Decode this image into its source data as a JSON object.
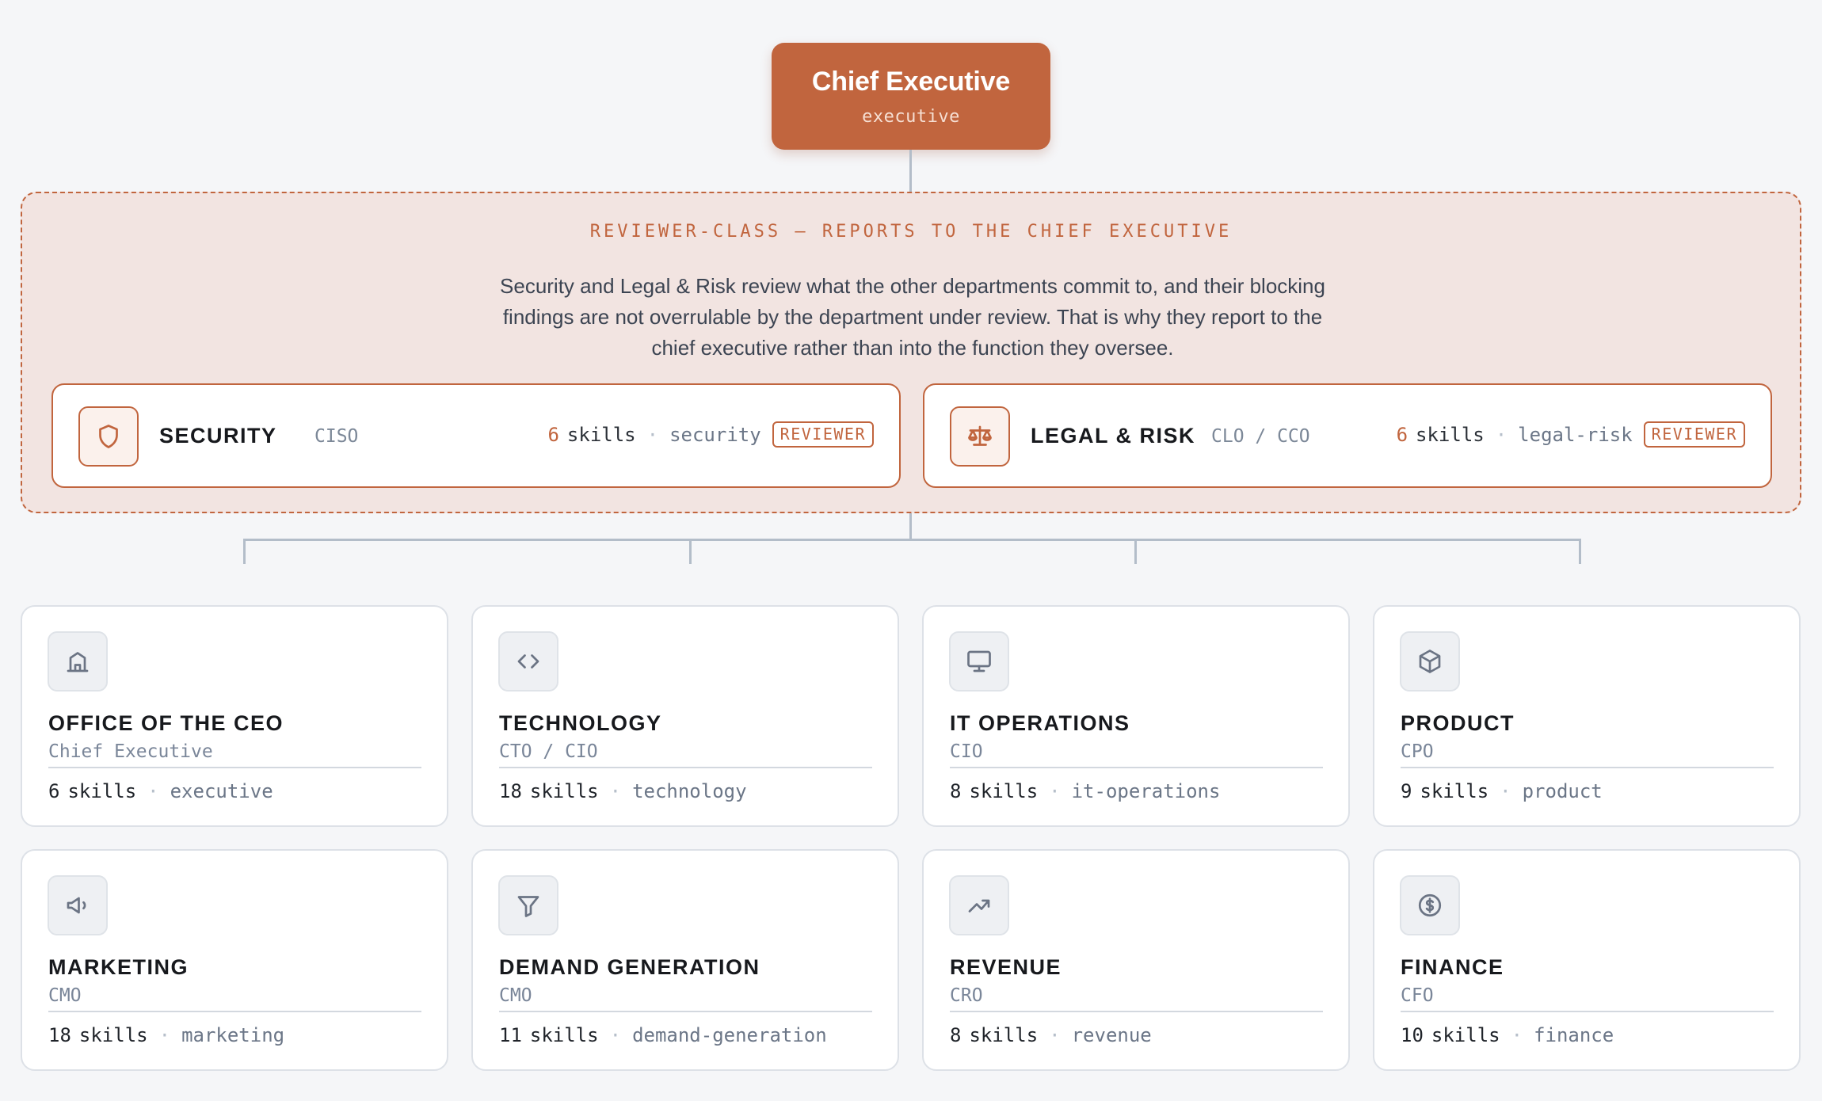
{
  "executive": {
    "title": "Chief Executive",
    "slug": "executive"
  },
  "reviewer_panel": {
    "heading": "REVIEWER-CLASS — REPORTS TO THE CHIEF EXECUTIVE",
    "description": "Security and Legal & Risk review what the other departments commit to, and their blocking findings are not overrulable by the department under review. That is why they report to the chief executive rather than into the function they oversee.",
    "cards": [
      {
        "icon": "shield-icon",
        "name": "SECURITY",
        "role": "CISO",
        "count": "6",
        "skills_label": "skills",
        "separator": "·",
        "slug": "security",
        "badge": "REVIEWER"
      },
      {
        "icon": "scales-icon",
        "name": "LEGAL & RISK",
        "role": "CLO / CCO",
        "count": "6",
        "skills_label": "skills",
        "separator": "·",
        "slug": "legal-risk",
        "badge": "REVIEWER"
      }
    ]
  },
  "departments": [
    {
      "icon": "building-icon",
      "name": "OFFICE OF THE CEO",
      "role": "Chief Executive",
      "count": "6",
      "skills_label": "skills",
      "separator": "·",
      "slug": "executive"
    },
    {
      "icon": "code-icon",
      "name": "TECHNOLOGY",
      "role": "CTO / CIO",
      "count": "18",
      "skills_label": "skills",
      "separator": "·",
      "slug": "technology"
    },
    {
      "icon": "monitor-icon",
      "name": "IT OPERATIONS",
      "role": "CIO",
      "count": "8",
      "skills_label": "skills",
      "separator": "·",
      "slug": "it-operations"
    },
    {
      "icon": "box-icon",
      "name": "PRODUCT",
      "role": "CPO",
      "count": "9",
      "skills_label": "skills",
      "separator": "·",
      "slug": "product"
    },
    {
      "icon": "megaphone-icon",
      "name": "MARKETING",
      "role": "CMO",
      "count": "18",
      "skills_label": "skills",
      "separator": "·",
      "slug": "marketing"
    },
    {
      "icon": "funnel-icon",
      "name": "DEMAND GENERATION",
      "role": "CMO",
      "count": "11",
      "skills_label": "skills",
      "separator": "·",
      "slug": "demand-generation"
    },
    {
      "icon": "trending-up-icon",
      "name": "REVENUE",
      "role": "CRO",
      "count": "8",
      "skills_label": "skills",
      "separator": "·",
      "slug": "revenue"
    },
    {
      "icon": "dollar-circle-icon",
      "name": "FINANCE",
      "role": "CFO",
      "count": "10",
      "skills_label": "skills",
      "separator": "·",
      "slug": "finance"
    }
  ],
  "colors": {
    "accent": "#c1653e",
    "panel_bg": "#f2e4e1",
    "page_bg": "#f5f6f8",
    "connector": "#b3bdc9"
  }
}
